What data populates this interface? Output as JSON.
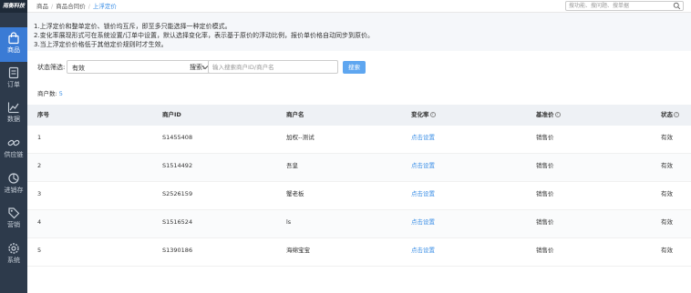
{
  "app": {
    "logo": "雨衡科技"
  },
  "sidebar": {
    "items": [
      {
        "label": "商品",
        "icon": "bag-icon",
        "active": true
      },
      {
        "label": "订单",
        "icon": "order-icon",
        "active": false
      },
      {
        "label": "数据",
        "icon": "chart-icon",
        "active": false
      },
      {
        "label": "供应链",
        "icon": "link-icon",
        "active": false
      },
      {
        "label": "进销存",
        "icon": "box-icon",
        "active": false
      },
      {
        "label": "营销",
        "icon": "tag-icon",
        "active": false
      },
      {
        "label": "系统",
        "icon": "gear-icon",
        "active": false
      }
    ]
  },
  "breadcrumb": {
    "items": [
      "商品",
      "商品合同价",
      "上浮定价"
    ]
  },
  "top_search": {
    "placeholder": "搜功能、搜问题、搜单据"
  },
  "notice": {
    "lines": [
      "1.上浮定价和整单定价、锁价均互斥，即至多只能选择一种定价模式。",
      "2.变化率展现形式可在系统设置/订单中设置，默认选择变化率，表示基于原价的浮动比例，报价单价格自动同步到原价。",
      "3.当上浮定价价格低于其他定价规则时才生效。"
    ]
  },
  "filters": {
    "status_label": "状态筛选:",
    "status_value": "有效",
    "keyword_label": "搜索:",
    "keyword_placeholder": "输入搜索商户ID/商户名",
    "search_button": "搜索"
  },
  "count": {
    "label": "商户数:",
    "value": "5"
  },
  "table": {
    "headers": [
      "序号",
      "商户ID",
      "商户名",
      "变化率",
      "基准价",
      "状态"
    ],
    "rows": [
      {
        "no": "1",
        "id": "S1455408",
        "name": "加权--测试",
        "rate": "点击设置",
        "base": "销售价",
        "status": "有效"
      },
      {
        "no": "2",
        "id": "S1514492",
        "name": "吾皇",
        "rate": "点击设置",
        "base": "销售价",
        "status": "有效"
      },
      {
        "no": "3",
        "id": "S2526159",
        "name": "蟹老板",
        "rate": "点击设置",
        "base": "销售价",
        "status": "有效"
      },
      {
        "no": "4",
        "id": "S1516524",
        "name": "ls",
        "rate": "点击设置",
        "base": "销售价",
        "status": "有效"
      },
      {
        "no": "5",
        "id": "S1390186",
        "name": "海绵宝宝",
        "rate": "点击设置",
        "base": "销售价",
        "status": "有效"
      }
    ]
  },
  "colors": {
    "sidebar_bg": "#2d3a4b",
    "active": "#3a7bd5",
    "accent": "#3a8ee6",
    "button": "#5ea6f0"
  }
}
